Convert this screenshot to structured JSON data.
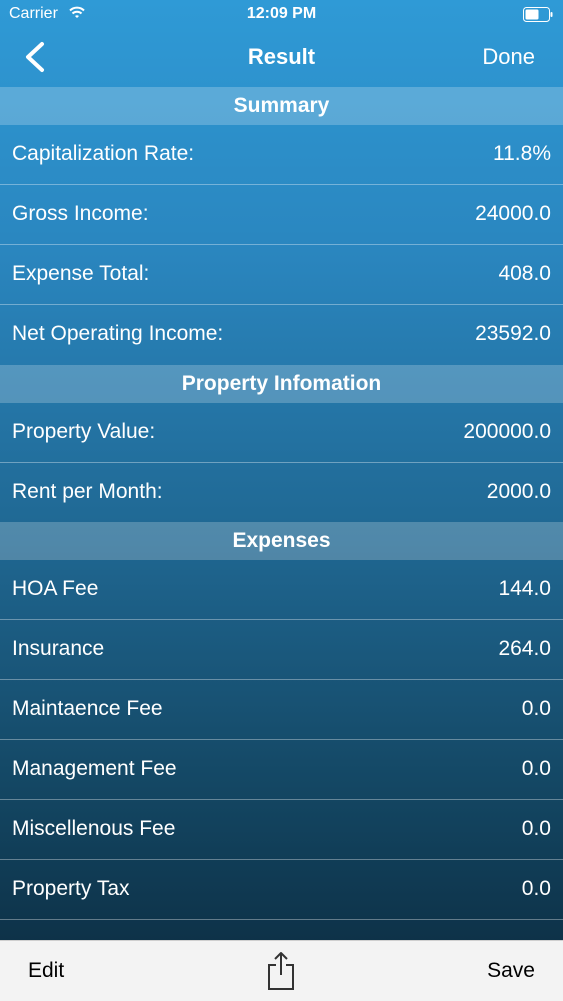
{
  "status": {
    "carrier": "Carrier",
    "time": "12:09 PM"
  },
  "nav": {
    "title": "Result",
    "done_label": "Done"
  },
  "sections": {
    "summary": "Summary",
    "property": "Property Infomation",
    "expenses": "Expenses"
  },
  "summary_rows": [
    {
      "label": "Capitalization Rate:",
      "value": "11.8%"
    },
    {
      "label": "Gross Income:",
      "value": "24000.0"
    },
    {
      "label": "Expense Total:",
      "value": "408.0"
    },
    {
      "label": "Net Operating Income:",
      "value": "23592.0"
    }
  ],
  "property_rows": [
    {
      "label": "Property Value:",
      "value": "200000.0"
    },
    {
      "label": "Rent per Month:",
      "value": "2000.0"
    }
  ],
  "expense_rows": [
    {
      "label": "HOA Fee",
      "value": "144.0"
    },
    {
      "label": "Insurance",
      "value": "264.0"
    },
    {
      "label": "Maintaence Fee",
      "value": "0.0"
    },
    {
      "label": "Management Fee",
      "value": "0.0"
    },
    {
      "label": "Miscellenous Fee",
      "value": "0.0"
    },
    {
      "label": "Property Tax",
      "value": "0.0"
    }
  ],
  "toolbar": {
    "edit_label": "Edit",
    "save_label": "Save"
  },
  "icons": {
    "back": "chevron-left-icon",
    "share": "share-icon",
    "wifi": "wifi-icon",
    "battery": "battery-icon"
  }
}
